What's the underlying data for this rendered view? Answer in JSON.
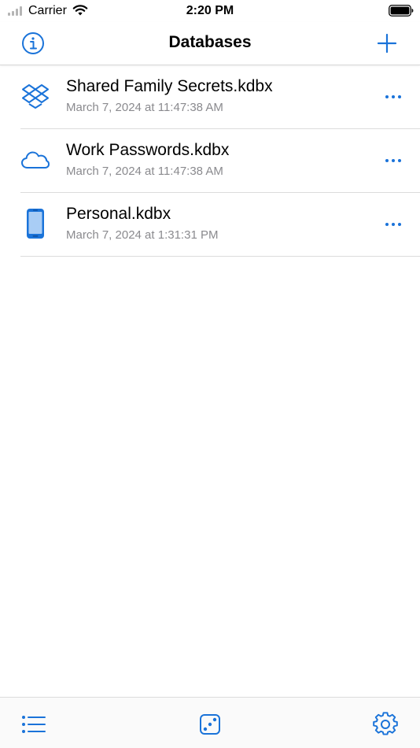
{
  "status_bar": {
    "carrier": "Carrier",
    "time": "2:20 PM"
  },
  "nav": {
    "title": "Databases",
    "left_icon": "info-icon",
    "right_icon": "plus-icon"
  },
  "databases": [
    {
      "name": "Shared Family Secrets.kdbx",
      "date": "March 7, 2024 at 11:47:38 AM",
      "icon": "dropbox-icon"
    },
    {
      "name": "Work Passwords.kdbx",
      "date": "March 7, 2024 at 11:47:38 AM",
      "icon": "cloud-icon"
    },
    {
      "name": "Personal.kdbx",
      "date": "March 7, 2024 at 1:31:31 PM",
      "icon": "phone-icon"
    }
  ],
  "toolbar": {
    "items": [
      "list-icon",
      "dice-icon",
      "gear-icon"
    ]
  },
  "colors": {
    "accent": "#1a73d9",
    "secondary_text": "#8a8a8e",
    "separator": "#dcdcdc"
  }
}
